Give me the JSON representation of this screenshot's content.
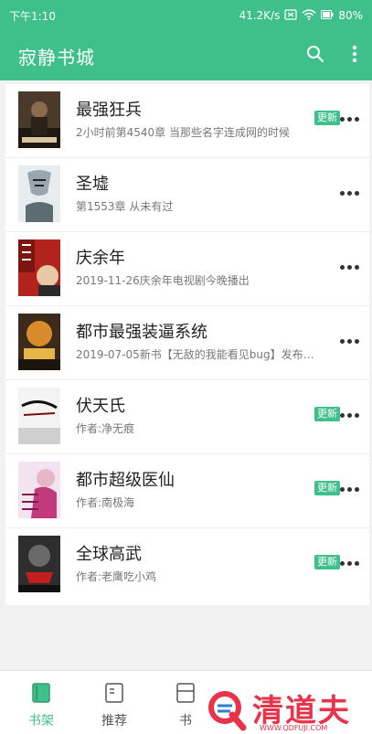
{
  "status": {
    "time": "下午1:10",
    "speed": "41.2K/s",
    "battery": "80%"
  },
  "app": {
    "title": "寂静书城",
    "search_icon": "search-icon",
    "menu_icon": "more-vert-icon"
  },
  "books": [
    {
      "title": "最强狂兵",
      "subtitle": "2小时前第4540章 当那些名字连成网的时候",
      "badge": "更新"
    },
    {
      "title": "圣墟",
      "subtitle": "第1553章 从未有过",
      "badge": ""
    },
    {
      "title": "庆余年",
      "subtitle": "2019-11-26庆余年电视剧今晚播出",
      "badge": ""
    },
    {
      "title": "都市最强装逼系统",
      "subtitle": "2019-07-05新书【无敌的我能看见bug】发布啦...",
      "badge": ""
    },
    {
      "title": "伏天氏",
      "subtitle": "作者:净无痕",
      "badge": "更新"
    },
    {
      "title": "都市超级医仙",
      "subtitle": "作者:南极海",
      "badge": "更新"
    },
    {
      "title": "全球高武",
      "subtitle": "作者:老鹰吃小鸡",
      "badge": "更新"
    }
  ],
  "tabs": [
    {
      "label": "书架",
      "icon": "bookshelf-icon",
      "active": true
    },
    {
      "label": "推荐",
      "icon": "book-open-icon",
      "active": false
    },
    {
      "label": "书",
      "icon": "library-icon",
      "active": false
    }
  ],
  "watermark": {
    "name": "清道夫",
    "url": "WWW.QDFUJI.COM"
  },
  "colors": {
    "primary": "#3fbf8a",
    "watermark": "#e8334a"
  }
}
